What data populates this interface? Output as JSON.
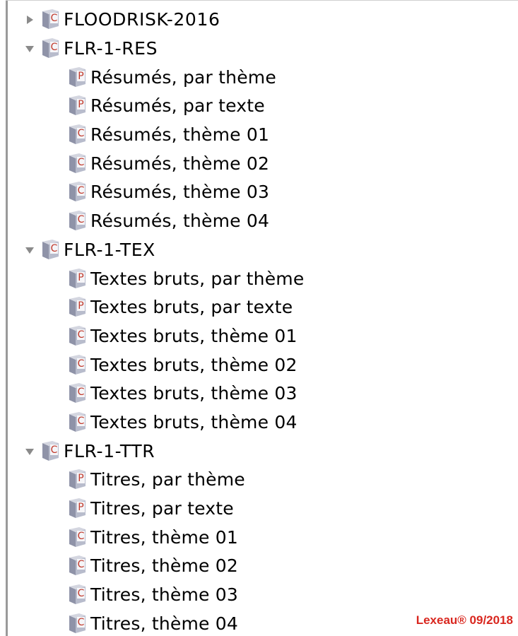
{
  "tree": {
    "groups": [
      {
        "label": "FLOODRISK-2016",
        "icon": "class-c-icon",
        "expanded": false,
        "children": []
      },
      {
        "label": "FLR-1-RES",
        "icon": "class-c-icon",
        "expanded": true,
        "children": [
          {
            "label": "Résumés, par thème",
            "icon": "class-p-icon"
          },
          {
            "label": "Résumés, par texte",
            "icon": "class-p-icon"
          },
          {
            "label": "Résumés, thème 01",
            "icon": "class-c-icon"
          },
          {
            "label": "Résumés, thème 02",
            "icon": "class-c-icon"
          },
          {
            "label": "Résumés, thème 03",
            "icon": "class-c-icon"
          },
          {
            "label": "Résumés, thème 04",
            "icon": "class-c-icon"
          }
        ]
      },
      {
        "label": "FLR-1-TEX",
        "icon": "class-c-icon",
        "expanded": true,
        "children": [
          {
            "label": "Textes bruts, par thème",
            "icon": "class-p-icon"
          },
          {
            "label": "Textes bruts, par texte",
            "icon": "class-p-icon"
          },
          {
            "label": "Textes bruts, thème 01",
            "icon": "class-c-icon"
          },
          {
            "label": "Textes bruts, thème 02",
            "icon": "class-c-icon"
          },
          {
            "label": "Textes bruts, thème 03",
            "icon": "class-c-icon"
          },
          {
            "label": "Textes bruts, thème 04",
            "icon": "class-c-icon"
          }
        ]
      },
      {
        "label": "FLR-1-TTR",
        "icon": "class-c-icon",
        "expanded": true,
        "children": [
          {
            "label": "Titres, par thème",
            "icon": "class-p-icon"
          },
          {
            "label": "Titres, par texte",
            "icon": "class-p-icon"
          },
          {
            "label": "Titres, thème 01",
            "icon": "class-c-icon"
          },
          {
            "label": "Titres, thème 02",
            "icon": "class-c-icon"
          },
          {
            "label": "Titres, thème 03",
            "icon": "class-c-icon"
          },
          {
            "label": "Titres, thème 04",
            "icon": "class-c-icon"
          }
        ]
      }
    ]
  },
  "watermark": "Lexeau® 09/2018",
  "colors": {
    "watermark": "#d9271f",
    "cube_face": "#b8bccc",
    "cube_side": "#8f93a8",
    "letter_c": "#c0392b",
    "letter_p": "#c0392b",
    "disclosure": "#8a8a8a"
  }
}
